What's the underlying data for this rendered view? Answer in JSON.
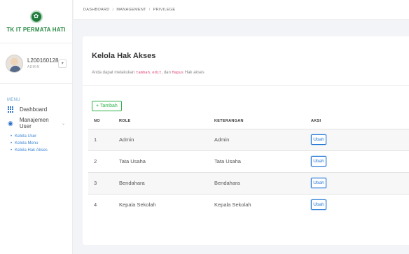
{
  "brand": {
    "name": "TK IT PERMATA HATI",
    "logo_icon": "school-logo-icon"
  },
  "user": {
    "name": "L200160128",
    "role": "ADMIN",
    "toggle_icon": "chevron-down-icon"
  },
  "menu": {
    "heading": "MENU",
    "items": [
      {
        "label": "Dashboard",
        "icon": "grid-icon"
      },
      {
        "label": "Manajemen User",
        "icon": "user-circle-icon"
      }
    ],
    "submenu": [
      {
        "label": "Kelola User"
      },
      {
        "label": "Kelola Menu"
      },
      {
        "label": "Kelola Hak Akses"
      }
    ]
  },
  "breadcrumb": [
    "DASHBOARD",
    "MANAGEMENT",
    "PRIVILEGE"
  ],
  "card": {
    "title": "Kelola Hak Akses",
    "desc_prefix": "Anda dapat melakukan ",
    "desc_kw1": "tambah",
    "desc_sep": ", ",
    "desc_kw2": "edit",
    "desc_mid": ", dan ",
    "desc_kw3": "Hapus",
    "desc_suffix": " Hak akses",
    "add_button": "+ Tambah"
  },
  "table": {
    "headers": {
      "no": "NO",
      "role": "ROLE",
      "keterangan": "KETERANGAN",
      "aksi": "AKSI"
    },
    "rows": [
      {
        "no": "1",
        "role": "Admin",
        "keterangan": "Admin",
        "action": "Ubah"
      },
      {
        "no": "2",
        "role": "Tata Usaha",
        "keterangan": "Tata Usaha",
        "action": "Ubah"
      },
      {
        "no": "3",
        "role": "Bendahara",
        "keterangan": "Bendahara",
        "action": "Ubah"
      },
      {
        "no": "4",
        "role": "Kepala Sekolah",
        "keterangan": "Kepala Sekolah",
        "action": "Ubah"
      }
    ]
  },
  "colors": {
    "brand_green": "#2a8a45",
    "link_blue": "#3d86d4",
    "add_green": "#2fb24a",
    "keyword_pink": "#e0447a"
  }
}
